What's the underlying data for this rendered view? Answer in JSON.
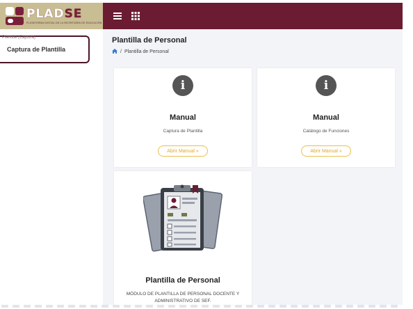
{
  "brand": {
    "name_part1": "PLAD",
    "name_part2": "SE",
    "subtitle": "PLATAFORMA DIGITAL DE LA SECRETARÍA DE EDUCACIÓN",
    "colors": {
      "accent": "#6b1c33",
      "brand_bg": "#c9bd93"
    }
  },
  "navbar": {
    "menu_icon": "hamburger-icon",
    "apps_icon": "grid-icon"
  },
  "sidebar": {
    "category": "Plantilla (Captura)",
    "items": [
      {
        "label": "Captura de Plantilla"
      }
    ]
  },
  "page": {
    "title": "Plantilla de Personal",
    "breadcrumb": {
      "home_icon": "home-icon",
      "separator": "/",
      "current": "Plantilla de Personal"
    }
  },
  "cards": [
    {
      "icon": "info-icon",
      "title": "Manual",
      "subtitle": "Captura de Plantilla",
      "button": "Abrir Manual »"
    },
    {
      "icon": "info-icon",
      "title": "Manual",
      "subtitle": "Catálogo de Funciones",
      "button": "Abrir Manual »"
    },
    {
      "icon": "clipboard-illustration",
      "title": "Plantilla de Personal",
      "description": "MÓDULO DE PLANTILLA DE PERSONAL DOCENTE Y ADMINISTRATIVO DE SEF."
    }
  ]
}
